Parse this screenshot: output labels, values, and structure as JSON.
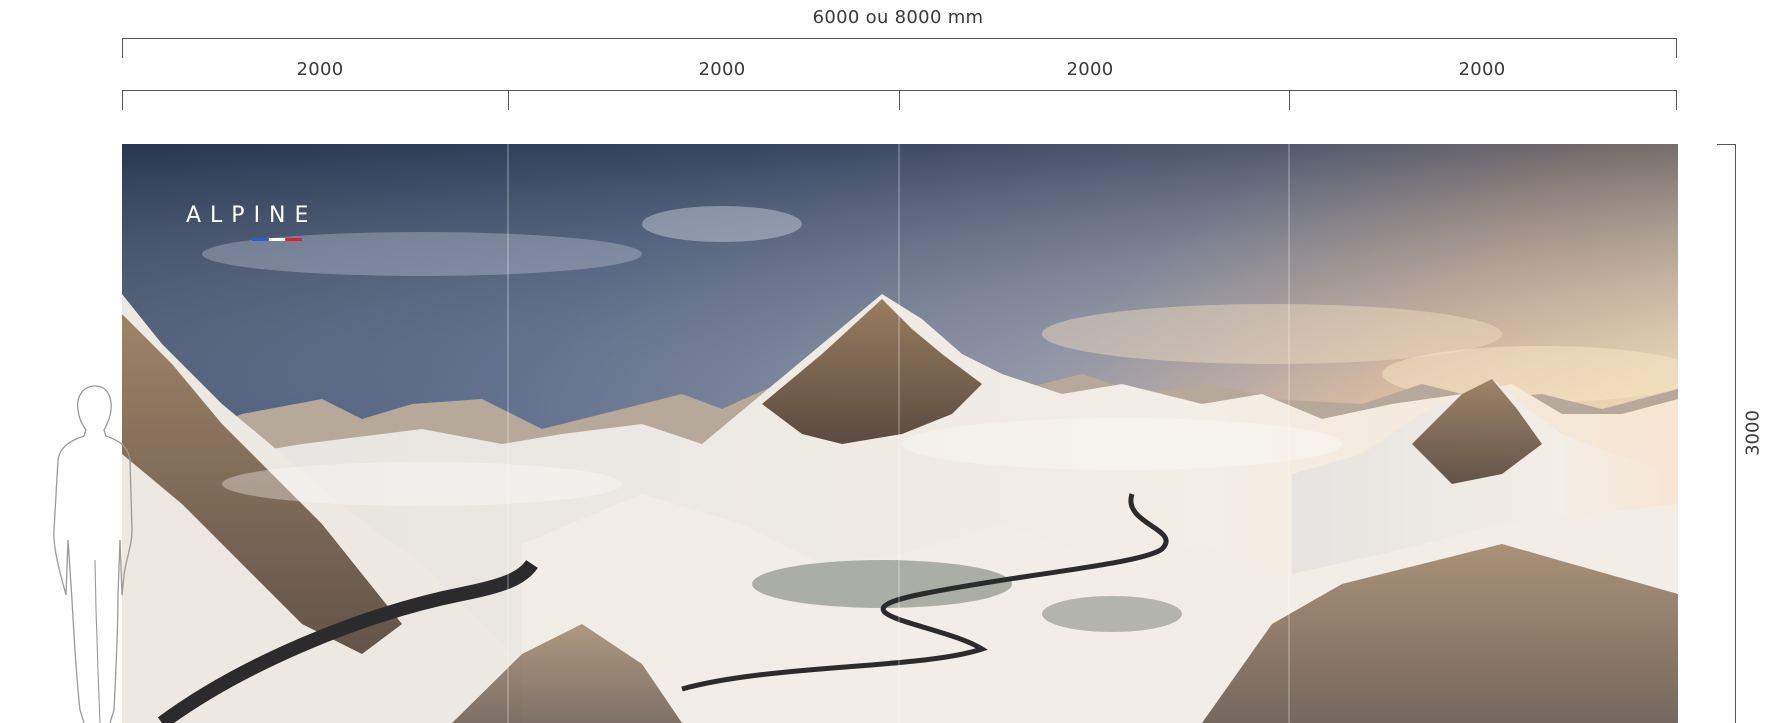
{
  "dimensions": {
    "total_width": "6000 ou 8000 mm",
    "segments": [
      "2000",
      "2000",
      "2000",
      "2000"
    ],
    "height": "3000"
  },
  "brand": {
    "name": "ALPINE",
    "stripe_colors": [
      "#2b5fc7",
      "#ffffff",
      "#e0202a"
    ]
  },
  "scene": {
    "sky_colors": [
      "#2c3a5c",
      "#6e7f9e",
      "#c9b7a6",
      "#e9c89a"
    ],
    "snow_color": "#efeae4",
    "rock_color": "#6b5039",
    "road_color": "#2b2b2d"
  }
}
